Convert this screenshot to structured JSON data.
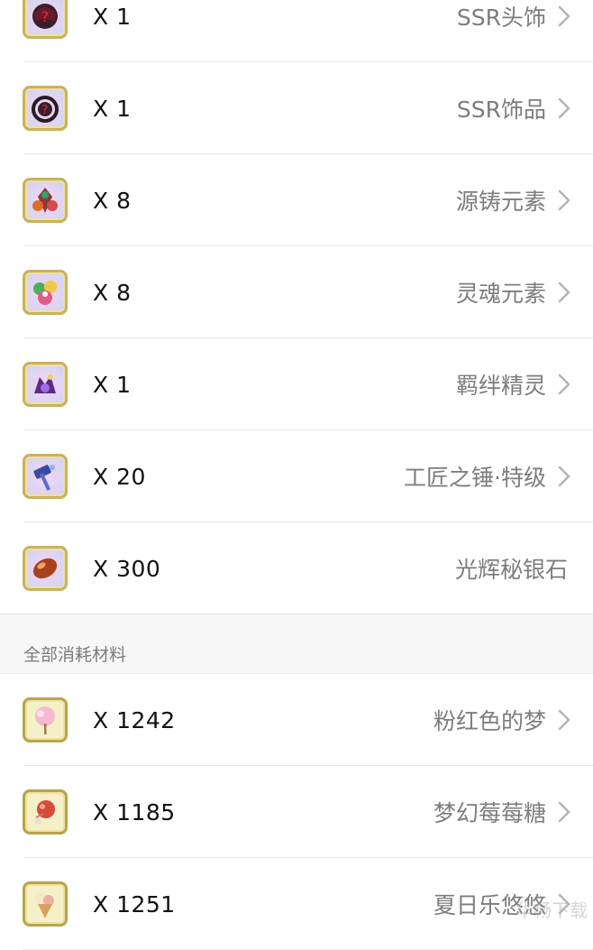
{
  "items_top": [
    {
      "qty": "X 1",
      "name": "SSR头饰",
      "arrow": true,
      "icon": "mystery-headgear-icon"
    },
    {
      "qty": "X 1",
      "name": "SSR饰品",
      "arrow": true,
      "icon": "mystery-accessory-icon"
    },
    {
      "qty": "X 8",
      "name": "源铸元素",
      "arrow": true,
      "icon": "forge-element-icon"
    },
    {
      "qty": "X 8",
      "name": "灵魂元素",
      "arrow": true,
      "icon": "soul-element-icon"
    },
    {
      "qty": "X 1",
      "name": "羁绊精灵",
      "arrow": true,
      "icon": "bond-spirit-icon"
    },
    {
      "qty": "X 20",
      "name": "工匠之锤·特级",
      "arrow": true,
      "icon": "craftsman-hammer-icon"
    },
    {
      "qty": "X 300",
      "name": "光辉秘银石",
      "arrow": false,
      "icon": "mithril-stone-icon"
    }
  ],
  "section_label": "全部消耗材料",
  "items_bottom": [
    {
      "qty": "X 1242",
      "name": "粉红色的梦",
      "arrow": true,
      "icon": "cotton-candy-icon"
    },
    {
      "qty": "X 1185",
      "name": "梦幻莓莓糖",
      "arrow": true,
      "icon": "berry-candy-icon"
    },
    {
      "qty": "X 1251",
      "name": "夏日乐悠悠",
      "arrow": true,
      "icon": "ice-cream-icon"
    }
  ],
  "watermark": "华畅下载"
}
